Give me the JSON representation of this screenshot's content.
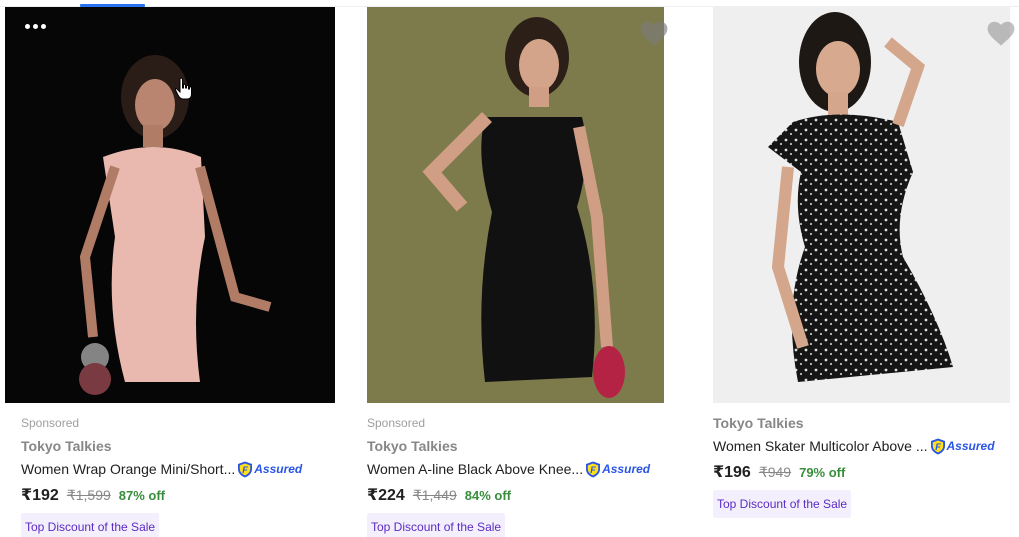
{
  "products": [
    {
      "sponsored_label": "Sponsored",
      "brand": "Tokyo Talkies",
      "title": "Women Wrap Orange Mini/Short...",
      "assured_label": "Assured",
      "price": "₹192",
      "mrp": "₹1,599",
      "discount": "87% off",
      "tag": "Top Discount of the Sale"
    },
    {
      "sponsored_label": "Sponsored",
      "brand": "Tokyo Talkies",
      "title": "Women A-line Black Above Knee...",
      "assured_label": "Assured",
      "price": "₹224",
      "mrp": "₹1,449",
      "discount": "84% off",
      "tag": "Top Discount of the Sale"
    },
    {
      "brand": "Tokyo Talkies",
      "title": "Women Skater Multicolor Above ...",
      "assured_label": "Assured",
      "price": "₹196",
      "mrp": "₹949",
      "discount": "79% off",
      "tag": "Top Discount of the Sale"
    }
  ],
  "icons": {
    "wishlist": "heart-icon",
    "carousel": "more-dots-icon",
    "assured": "flipkart-assured-icon",
    "pointer": "hand-cursor-icon"
  },
  "colors": {
    "accent": "#2874f0",
    "price": "#212121",
    "mrp": "#878787",
    "discount": "#388e3c",
    "assured": "#2a55e5",
    "tag_bg": "#f3effc",
    "tag_text": "#5b2bc4"
  }
}
